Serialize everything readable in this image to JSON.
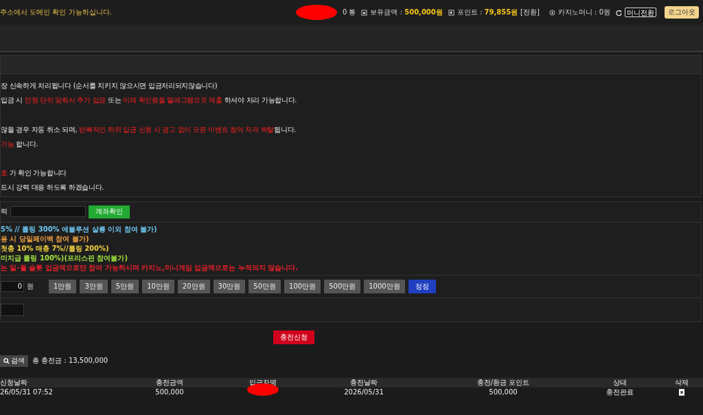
{
  "top_bar": {
    "notice": "주소에서 도메인 확인 가능하십니다.",
    "count": "0 통",
    "balance_label": "보유금액 : ",
    "balance": "500,000원",
    "points_label": "포인트 : ",
    "points": "79,855원",
    "points_action": "[전환]",
    "casino_label": "카지노머니 : 0원",
    "convert_button": "머니전환",
    "logout_button": "로그아웃"
  },
  "notices": [
    {
      "segments": [
        {
          "text": "장 신속하게 처리됩니다 (순서를 지키지 않으시면 입금처리되지않습니다)",
          "highlight": false
        }
      ]
    },
    {
      "segments": [
        {
          "text": "입금 시 ",
          "highlight": false
        },
        {
          "text": "만원 단위 맞춰서 추가 입금",
          "highlight": true
        },
        {
          "text": " 또는 ",
          "highlight": false
        },
        {
          "text": "이체 확인증을 텔레그램으로 제출",
          "highlight": true
        },
        {
          "text": " 하셔야 처리 가능합니다.",
          "highlight": false
        }
      ]
    },
    {
      "segments": [
        {
          "text": "않을 경우 자동 취소 되며, ",
          "highlight": false
        },
        {
          "text": "반복적인 허위 입금 신청 시 경고 없이 모든 이벤트 참여 자격 박탈",
          "highlight": true
        },
        {
          "text": "됩니다.",
          "highlight": false
        }
      ]
    },
    {
      "segments": [
        {
          "text": "가능",
          "highlight": true
        },
        {
          "text": " 합니다.",
          "highlight": false
        }
      ]
    },
    {
      "segments": [
        {
          "text": "호",
          "highlight": true
        },
        {
          "text": " 가 확인 가능합니다",
          "highlight": false
        }
      ]
    },
    {
      "segments": [
        {
          "text": "드시 강력 대응 하도록 하겠습니다.",
          "highlight": false
        }
      ]
    }
  ],
  "account": {
    "label": "력",
    "button": "계좌확인"
  },
  "bonus_lines": [
    {
      "text": "5% // 롤링 300% 에볼루션 살롱 이외 참여 불가)",
      "color": "#6ec6f0"
    },
    {
      "text": "용 시 당일페이백 참여 불가)",
      "color": "#f0a040"
    },
    {
      "text": "첫충 10% 매충 7%//롤링 200%)",
      "color": "#f0d040"
    },
    {
      "text": "미지급 롤링 100%)(프리스핀 참여불가)",
      "color": "#a0e040"
    },
    {
      "text": "는 일-월 슬롯 입금액으로만 참여 가능하시며 카지노,미니게임 입금액으로는 누적되지 않습니다.",
      "color": "#e8202a"
    }
  ],
  "amount": {
    "value": "0",
    "unit": "원",
    "presets": [
      "1만원",
      "3만원",
      "5만원",
      "10만원",
      "20만원",
      "30만원",
      "50만원",
      "100만원",
      "500만원",
      "1000만원"
    ],
    "reset_button": "정정"
  },
  "submit_button": "충전신청",
  "search": {
    "button": "검색",
    "total": "총 충전금 : 13,500,000"
  },
  "table": {
    "columns": [
      "신청날짜",
      "충전금액",
      "입금자명",
      "충전날짜",
      "충전/환금 포인트",
      "상태",
      "삭제"
    ],
    "rows": [
      {
        "requested": "26/05/31 07:52",
        "amount": "500,000",
        "charged": "2026/05/31",
        "points": "500,000",
        "status": "충전완료"
      }
    ]
  }
}
